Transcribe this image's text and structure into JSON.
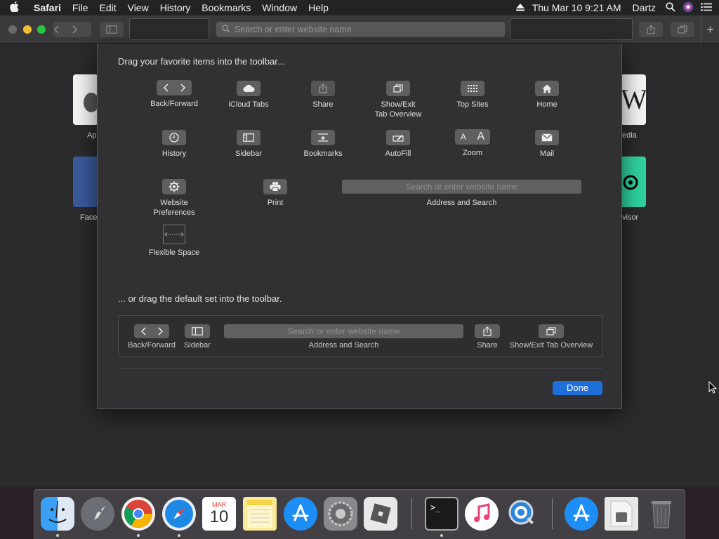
{
  "menubar": {
    "app": "Safari",
    "items": [
      "File",
      "Edit",
      "View",
      "History",
      "Bookmarks",
      "Window",
      "Help"
    ],
    "clock": "Thu Mar 10  9:21 AM",
    "user": "Dartz"
  },
  "toolbar": {
    "address_placeholder": "Search or enter website name"
  },
  "favorites": {
    "apple_label": "Ap",
    "facebook_label": "Face",
    "wiki_label": "edia",
    "wiki_glyph": "W",
    "trip_label": "visor"
  },
  "sheet": {
    "heading": "Drag your favorite items into the toolbar...",
    "items": {
      "back_forward": "Back/Forward",
      "icloud_tabs": "iCloud Tabs",
      "share": "Share",
      "show_exit_tab_overview": "Show/Exit\nTab Overview",
      "top_sites": "Top Sites",
      "home": "Home",
      "history": "History",
      "sidebar": "Sidebar",
      "bookmarks": "Bookmarks",
      "autofill": "AutoFill",
      "zoom": "Zoom",
      "mail": "Mail",
      "website_preferences": "Website\nPreferences",
      "print": "Print",
      "address_and_search": "Address and Search",
      "flexible_space": "Flexible Space"
    },
    "address_placeholder": "Search or enter website name",
    "default_heading": "... or drag the default set into the toolbar.",
    "default_set": {
      "back_forward": "Back/Forward",
      "sidebar": "Sidebar",
      "address_and_search": "Address and Search",
      "share": "Share",
      "show_exit_tab_overview": "Show/Exit Tab Overview"
    },
    "done": "Done",
    "accent": "#1e6fd9"
  },
  "dock": {
    "calendar_month": "MAR",
    "calendar_day": "10"
  }
}
